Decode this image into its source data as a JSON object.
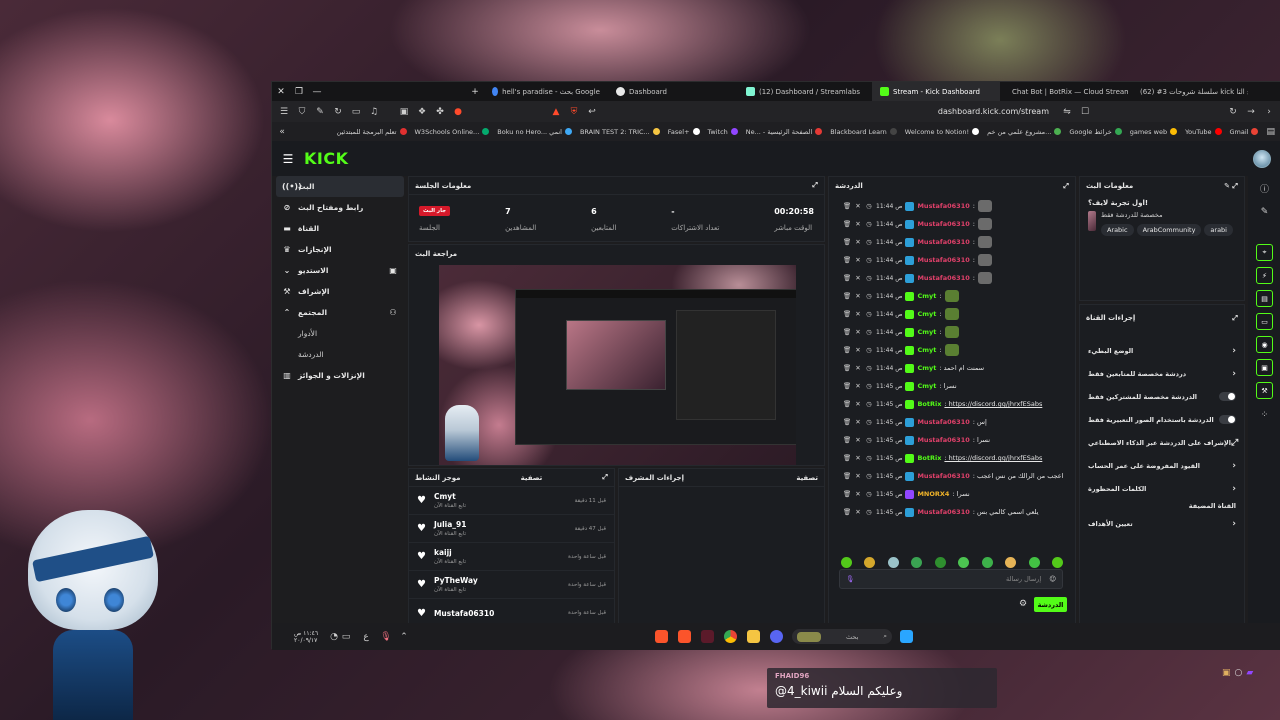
{
  "tabs": [
    {
      "label": "hell's paradise - بحث Google",
      "color": "#4285f4"
    },
    {
      "label": "Dashboard",
      "color": "#e8e8e8"
    },
    {
      "label": "(12) Dashboard / Streamlabs",
      "color": "#80f5d2"
    },
    {
      "label": "Stream - Kick Dashboard",
      "color": "#53fc18",
      "active": true
    },
    {
      "label": "Chat Bot | BotRix — Cloud Streaming…",
      "color": "#3ad6a6"
    },
    {
      "label": "(62) #3 سلسلة شروحات kick الشرح التا",
      "color": "#ff0000"
    }
  ],
  "url": "dashboard.kick.com/stream",
  "bookmarks": [
    {
      "label": "تعلم البرمجة للمبتدئين",
      "color": "#e03030"
    },
    {
      "label": "W3Schools Online...",
      "color": "#04aa6d"
    },
    {
      "label": "Boku no Hero... انمي",
      "color": "#3fa9f5"
    },
    {
      "label": "BRAIN TEST 2: TRIC...",
      "color": "#f5c542"
    },
    {
      "label": "Fasel+",
      "color": "#ffffff"
    },
    {
      "label": "Twitch",
      "color": "#9146ff"
    },
    {
      "label": "Ne... - الصفحة الرئيسية",
      "color": "#e53935"
    },
    {
      "label": "Blackboard Learn",
      "color": "#222222"
    },
    {
      "label": "Welcome to Notion!",
      "color": "#ffffff"
    },
    {
      "label": "مشروع علمي من خم...",
      "color": "#4caf50"
    },
    {
      "label": "Google خرائط",
      "color": "#34a853"
    },
    {
      "label": "games web",
      "color": "#fbbc05"
    },
    {
      "label": "YouTube",
      "color": "#ff0000"
    },
    {
      "label": "Gmail",
      "color": "#ea4335"
    }
  ],
  "kick": {
    "logo": "KICK",
    "logo_color": "#53fc18"
  },
  "nav": {
    "stream": "البث",
    "stream_key": "رابط ومفتاح البث",
    "channel": "القناة",
    "achievements": "الإنجازات",
    "studio": "الاستديو",
    "moderation": "الإشراف",
    "community": "المجتمع",
    "roles": "الأدوار",
    "chat": "الدردشة",
    "payouts": "الإنزالات و الجوائز"
  },
  "session": {
    "title": "معلومات الجلسة",
    "stats": [
      {
        "label": "الوقت مباشر",
        "value": "00:20:58"
      },
      {
        "label": "تعداد الاشتراكات",
        "value": "-"
      },
      {
        "label": "المتابعين",
        "value": "6"
      },
      {
        "label": "المشاهدين",
        "value": "7"
      },
      {
        "label": "الجلسة",
        "value": "جار البث"
      }
    ]
  },
  "preview": {
    "title": "مراجعة البث"
  },
  "activity": {
    "title": "موجز النشاط",
    "filter": "تصفية",
    "items": [
      {
        "name": "Cmyt",
        "sub": "تابع القناة الآن",
        "time": "قبل 11 دقيقة"
      },
      {
        "name": "Julia_91",
        "sub": "تابع القناة الآن",
        "time": "قبل 47 دقيقة"
      },
      {
        "name": "kaijj",
        "sub": "تابع القناة الآن",
        "time": "قبل ساعة واحدة"
      },
      {
        "name": "PyTheWay",
        "sub": "تابع القناة الآن",
        "time": "قبل ساعة واحدة"
      },
      {
        "name": "Mustafa06310",
        "sub": "",
        "time": "قبل ساعة واحدة"
      }
    ]
  },
  "modactions": {
    "title": "إجراءات المشرف",
    "filter": "تصفية"
  },
  "chat": {
    "title": "الدردشة",
    "input_placeholder": "إرسال رسالة",
    "send": "الدردشة",
    "messages": [
      {
        "time": "11:44 ص",
        "user": "Mustafa06310",
        "color": "#e0406a",
        "badge": "#2d9fd8",
        "msg": ":"
      },
      {
        "time": "11:44 ص",
        "user": "Mustafa06310",
        "color": "#e0406a",
        "badge": "#2d9fd8",
        "msg": ":"
      },
      {
        "time": "11:44 ص",
        "user": "Mustafa06310",
        "color": "#e0406a",
        "badge": "#2d9fd8",
        "msg": ":"
      },
      {
        "time": "11:44 ص",
        "user": "Mustafa06310",
        "color": "#e0406a",
        "badge": "#2d9fd8",
        "msg": ":"
      },
      {
        "time": "11:44 ص",
        "user": "Mustafa06310",
        "color": "#e0406a",
        "badge": "#2d9fd8",
        "msg": ":"
      },
      {
        "time": "11:44 ص",
        "user": "Cmyt",
        "color": "#53fc18",
        "badge": "#53fc18",
        "msg": ":"
      },
      {
        "time": "11:44 ص",
        "user": "Cmyt",
        "color": "#53fc18",
        "badge": "#53fc18",
        "msg": ":"
      },
      {
        "time": "11:44 ص",
        "user": "Cmyt",
        "color": "#53fc18",
        "badge": "#53fc18",
        "msg": ":"
      },
      {
        "time": "11:44 ص",
        "user": "Cmyt",
        "color": "#53fc18",
        "badge": "#53fc18",
        "msg": ":"
      },
      {
        "time": "11:44 ص",
        "user": "Cmyt",
        "color": "#53fc18",
        "badge": "#53fc18",
        "msg": ": سمنت ام احمد"
      },
      {
        "time": "11:45 ص",
        "user": "Cmyt",
        "color": "#53fc18",
        "badge": "#53fc18",
        "msg": ": نسرا"
      },
      {
        "time": "11:45 ص",
        "user": "BotRix",
        "color": "#53fc18",
        "badge": "#53fc18",
        "msg": ": https://discord.gg/jhrxfESabs"
      },
      {
        "time": "11:45 ص",
        "user": "Mustafa06310",
        "color": "#e0406a",
        "badge": "#2d9fd8",
        "msg": ": إس"
      },
      {
        "time": "11:45 ص",
        "user": "Mustafa06310",
        "color": "#e0406a",
        "badge": "#2d9fd8",
        "msg": ": نسرا"
      },
      {
        "time": "11:45 ص",
        "user": "BotRix",
        "color": "#53fc18",
        "badge": "#53fc18",
        "msg": ": https://discord.gg/jhrxfESabs"
      },
      {
        "time": "11:45 ص",
        "user": "Mustafa06310",
        "color": "#e0406a",
        "badge": "#2d9fd8",
        "msg": ": اعجب من الرالك من نس اعجب"
      },
      {
        "time": "11:45 ص",
        "user": "MNORX4",
        "color": "#f0b429",
        "badge": "#9146ff",
        "msg": ": نسرا"
      },
      {
        "time": "11:45 ص",
        "user": "Mustafa06310",
        "color": "#e0406a",
        "badge": "#2d9fd8",
        "msg": ": يلعي اسمي كالمي بس"
      }
    ]
  },
  "stream_info": {
    "title": "معلومات البث",
    "stream_title": "اول تجربة لايف؟!",
    "category": "مخصصة للدردشة فقط",
    "tags": [
      "arabi",
      "ArabCommunity",
      "Arabic"
    ]
  },
  "channel_actions": {
    "title": "إجراءات القناة",
    "items": [
      {
        "label": "الوضع البطيء",
        "control": "chevron"
      },
      {
        "label": "دردشة مخصصة للمتابعين فقط",
        "control": "chevron"
      },
      {
        "label": "الدردشة مخصصة للمشتركين فقط",
        "control": "toggle"
      },
      {
        "label": "الدردشة باستخدام الصور التعبيرية فقط",
        "control": "toggle"
      },
      {
        "label": "الإشراف على الدردشة عبر الذكاء الاصطناعي",
        "control": "link"
      },
      {
        "label": "القيود المفروضة على عمر الحساب",
        "control": "chevron"
      },
      {
        "label": "الكلمات المحظورة",
        "control": "chevron"
      }
    ],
    "target_section": "القناة المضيفة",
    "targets_label": "تعيين الأهداف"
  },
  "taskbar": {
    "time": "١١:٤٦ ص",
    "date": "٢٠/٠٩/١٧",
    "lang": "ع",
    "search": "بحث"
  },
  "overlay_chat": {
    "user": "FHAID96",
    "message": "@4_kiwii وعليكم السلام"
  }
}
